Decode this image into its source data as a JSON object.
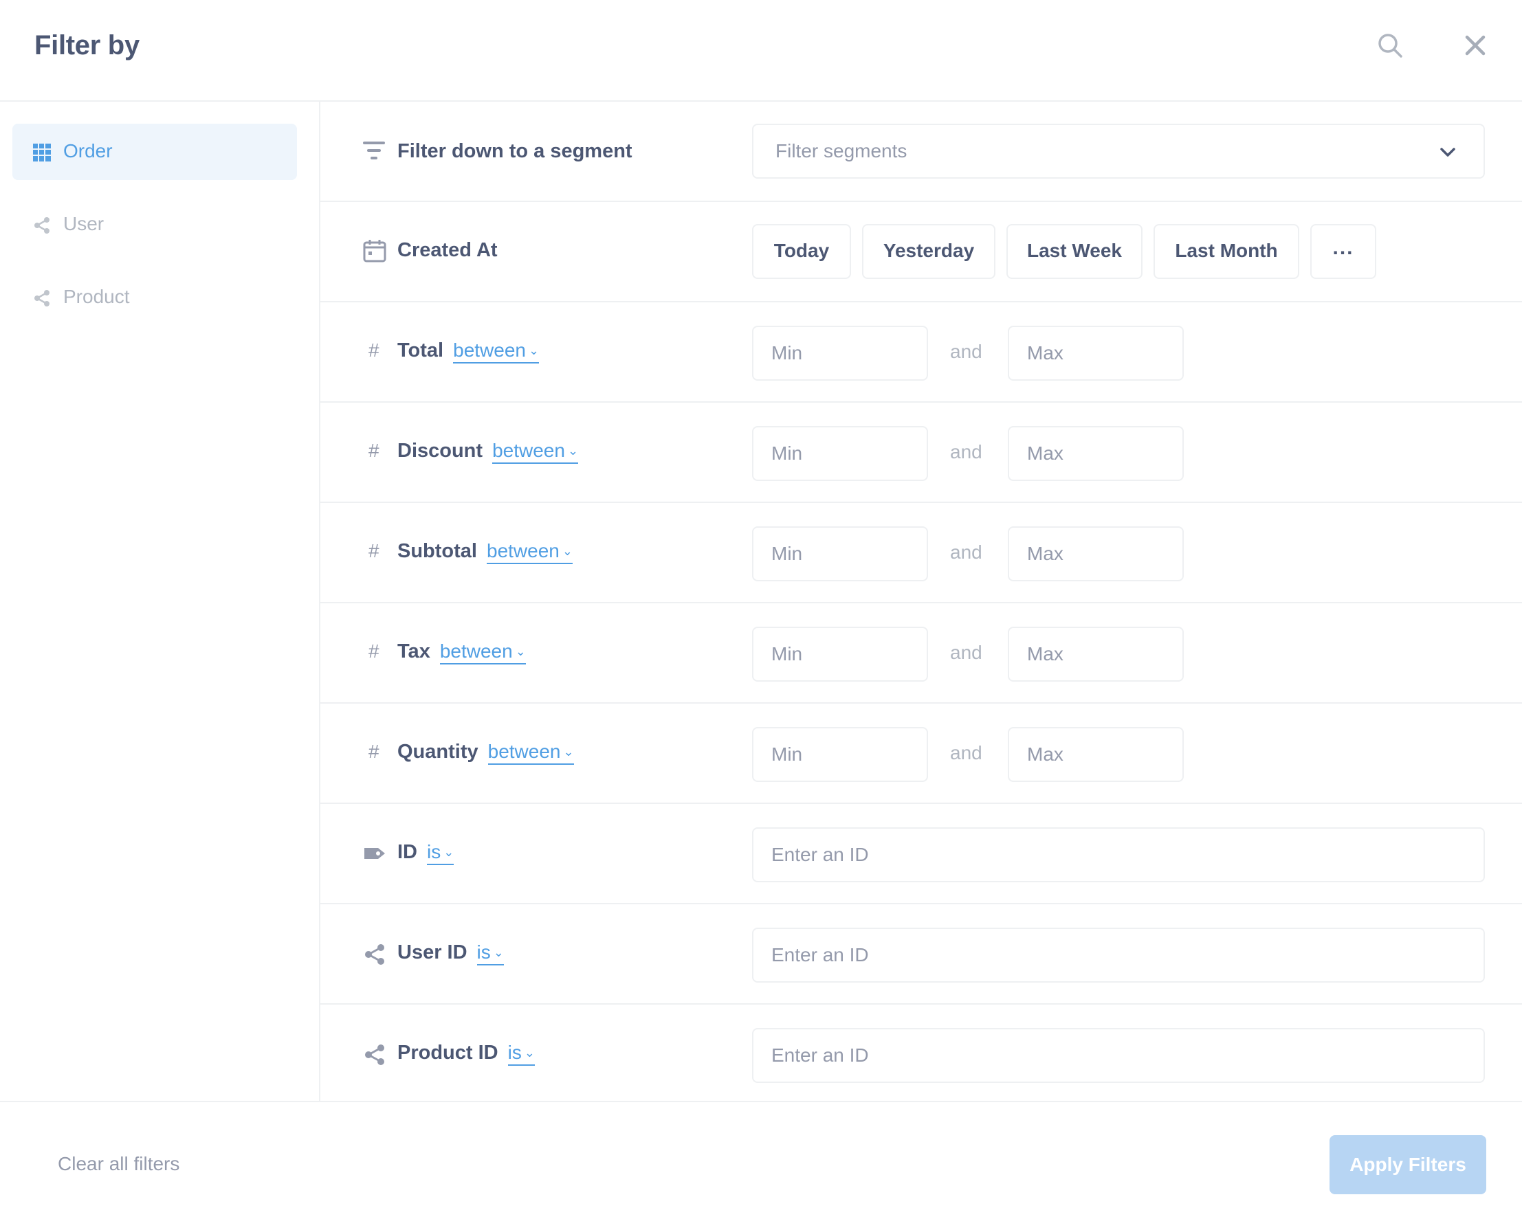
{
  "header": {
    "title": "Filter by"
  },
  "sidebar": {
    "items": [
      {
        "label": "Order",
        "icon": "table-grid-icon",
        "active": true
      },
      {
        "label": "User",
        "icon": "connection-icon",
        "active": false
      },
      {
        "label": "Product",
        "icon": "connection-icon",
        "active": false
      }
    ]
  },
  "segment": {
    "label": "Filter down to a segment",
    "placeholder": "Filter segments"
  },
  "created_at": {
    "label": "Created At",
    "shortcuts": [
      "Today",
      "Yesterday",
      "Last Week",
      "Last Month"
    ],
    "more": "..."
  },
  "numeric_filters": [
    {
      "label": "Total",
      "operator": "between",
      "min_placeholder": "Min",
      "and": "and",
      "max_placeholder": "Max"
    },
    {
      "label": "Discount",
      "operator": "between",
      "min_placeholder": "Min",
      "and": "and",
      "max_placeholder": "Max"
    },
    {
      "label": "Subtotal",
      "operator": "between",
      "min_placeholder": "Min",
      "and": "and",
      "max_placeholder": "Max"
    },
    {
      "label": "Tax",
      "operator": "between",
      "min_placeholder": "Min",
      "and": "and",
      "max_placeholder": "Max"
    },
    {
      "label": "Quantity",
      "operator": "between",
      "min_placeholder": "Min",
      "and": "and",
      "max_placeholder": "Max"
    }
  ],
  "hash_symbol": "#",
  "chevron": "⌄",
  "id_filters": [
    {
      "label": "ID",
      "operator": "is",
      "placeholder": "Enter an ID",
      "icon": "tag-icon"
    },
    {
      "label": "User ID",
      "operator": "is",
      "placeholder": "Enter an ID",
      "icon": "connection-icon"
    },
    {
      "label": "Product ID",
      "operator": "is",
      "placeholder": "Enter an ID",
      "icon": "connection-icon"
    }
  ],
  "footer": {
    "clear_label": "Clear all filters",
    "apply_label": "Apply Filters"
  },
  "colors": {
    "brand": "#509ee3",
    "text": "#4c5773",
    "muted": "#949aab",
    "border": "#eef0f2",
    "apply_disabled": "#b7d5f3"
  }
}
